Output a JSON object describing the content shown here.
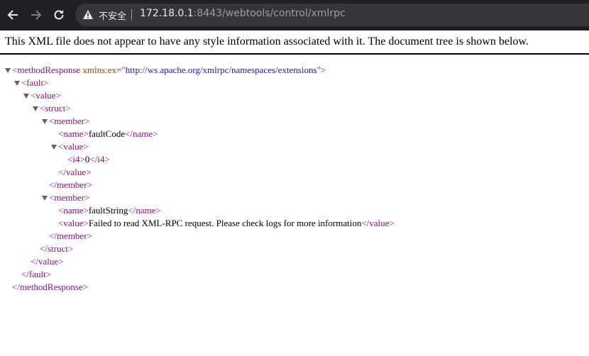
{
  "browser": {
    "security_label": "不安全",
    "url_host": "172.18.0.1",
    "url_rest": ":8443/webtools/control/xmlrpc"
  },
  "info_message": "This XML file does not appear to have any style information associated with it. The document tree is shown below.",
  "xml": {
    "methodResponse_open": "<methodResponse",
    "attr_name": "xmlns:ex",
    "attr_eq": "=\"",
    "attr_value": "http://ws.apache.org/xmlrpc/namespaces/extensions",
    "attr_close": "\">",
    "fault_open": "<fault>",
    "value_open": "<value>",
    "struct_open": "<struct>",
    "member_open": "<member>",
    "name_open": "<name>",
    "faultCode": "faultCode",
    "name_close": "</name>",
    "i4_open": "<i4>",
    "i4_value": "0",
    "i4_close": "</i4>",
    "value_close": "</value>",
    "member_close": "</member>",
    "faultString": "faultString",
    "fault_message": "Failed to read XML-RPC request. Please check logs for more information",
    "struct_close": "</struct>",
    "fault_close": "</fault>",
    "methodResponse_close": "</methodResponse>"
  }
}
